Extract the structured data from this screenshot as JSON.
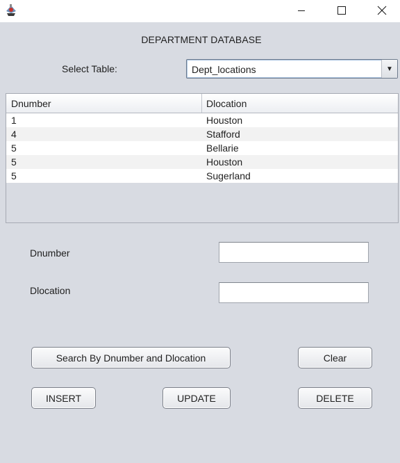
{
  "window": {
    "minimize_icon": "minimize-icon",
    "maximize_icon": "maximize-icon",
    "close_icon": "close-icon",
    "app_icon": "java-cup-icon"
  },
  "heading": "DEPARTMENT DATABASE",
  "table_select": {
    "label": "Select Table:",
    "value": "Dept_locations",
    "arrow_glyph": "▼"
  },
  "table": {
    "columns": [
      "Dnumber",
      "Dlocation"
    ],
    "rows": [
      [
        "1",
        "Houston"
      ],
      [
        "4",
        "Stafford"
      ],
      [
        "5",
        "Bellarie"
      ],
      [
        "5",
        "Houston"
      ],
      [
        "5",
        "Sugerland"
      ]
    ]
  },
  "form": {
    "dnumber_label": "Dnumber",
    "dnumber_value": "",
    "dlocation_label": "Dlocation",
    "dlocation_value": ""
  },
  "buttons": {
    "search": "Search By Dnumber and Dlocation",
    "clear": "Clear",
    "insert": "INSERT",
    "update": "UPDATE",
    "delete": "DELETE"
  },
  "colors": {
    "background": "#d8dbe2",
    "titlebar": "#ffffff",
    "row_alt": "#f2f2f2",
    "select_focus": "#a9c3e0"
  }
}
